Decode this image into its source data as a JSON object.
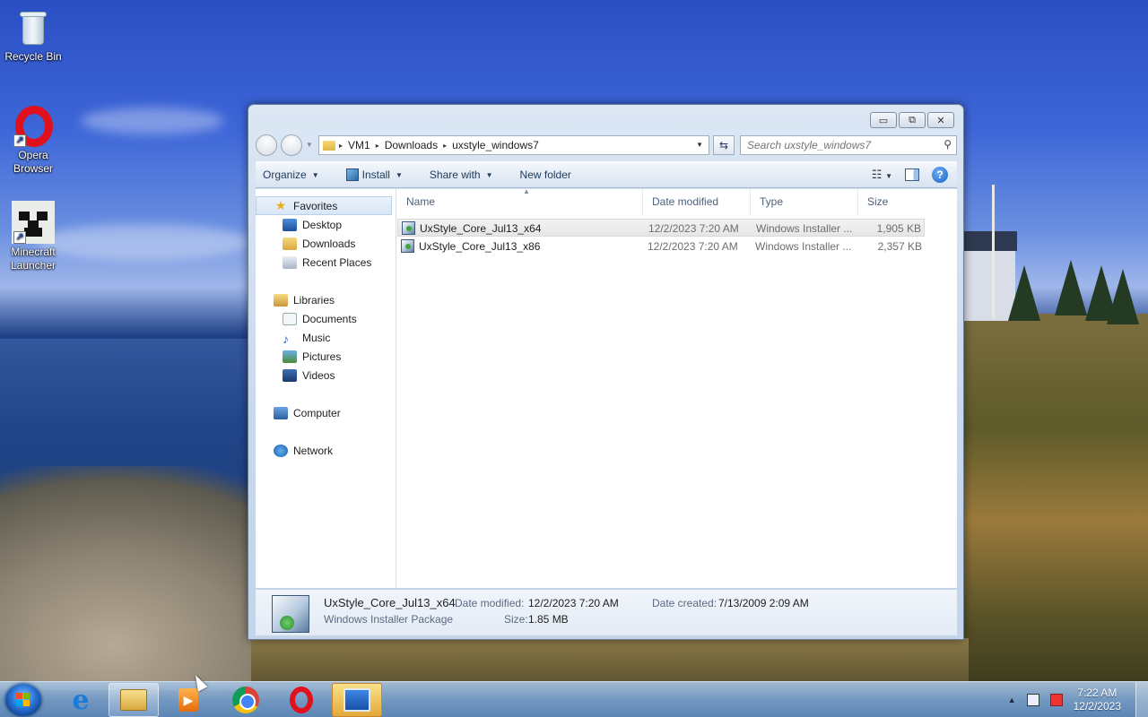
{
  "desktop": {
    "icons": [
      {
        "label": "Recycle Bin",
        "icon": "recycle-bin-icon"
      },
      {
        "label": "Opera Browser",
        "icon": "opera-icon"
      },
      {
        "label": "Minecraft Launcher",
        "icon": "minecraft-icon"
      }
    ]
  },
  "window": {
    "caption_buttons": {
      "minimize": "▭",
      "maximize": "⧉",
      "close": "✕"
    },
    "address": {
      "segments": [
        "VM1",
        "Downloads",
        "uxstyle_windows7"
      ],
      "separator": "▸"
    },
    "search": {
      "placeholder": "Search uxstyle_windows7"
    },
    "toolbar": {
      "organize": "Organize",
      "install": "Install",
      "share_with": "Share with",
      "new_folder": "New folder",
      "help": "?"
    },
    "navpane": {
      "favorites": {
        "label": "Favorites",
        "items": [
          "Desktop",
          "Downloads",
          "Recent Places"
        ]
      },
      "libraries": {
        "label": "Libraries",
        "items": [
          "Documents",
          "Music",
          "Pictures",
          "Videos"
        ]
      },
      "computer": "Computer",
      "network": "Network"
    },
    "columns": {
      "name": "Name",
      "date_modified": "Date modified",
      "type": "Type",
      "size": "Size"
    },
    "files": [
      {
        "name": "UxStyle_Core_Jul13_x64",
        "date_modified": "12/2/2023 7:20 AM",
        "type": "Windows Installer ...",
        "size": "1,905 KB",
        "selected": true
      },
      {
        "name": "UxStyle_Core_Jul13_x86",
        "date_modified": "12/2/2023 7:20 AM",
        "type": "Windows Installer ...",
        "size": "2,357 KB",
        "selected": false
      }
    ],
    "details": {
      "name": "UxStyle_Core_Jul13_x64",
      "type": "Windows Installer Package",
      "date_modified_label": "Date modified:",
      "date_modified": "12/2/2023 7:20 AM",
      "size_label": "Size:",
      "size": "1.85 MB",
      "date_created_label": "Date created:",
      "date_created": "7/13/2009 2:09 AM"
    }
  },
  "taskbar": {
    "apps": [
      "internet-explorer-icon",
      "windows-explorer-icon",
      "media-player-icon",
      "chrome-icon",
      "opera-icon",
      "remote-desktop-icon"
    ],
    "tray_up": "▲",
    "clock": {
      "time": "7:22 AM",
      "date": "12/2/2023"
    }
  }
}
